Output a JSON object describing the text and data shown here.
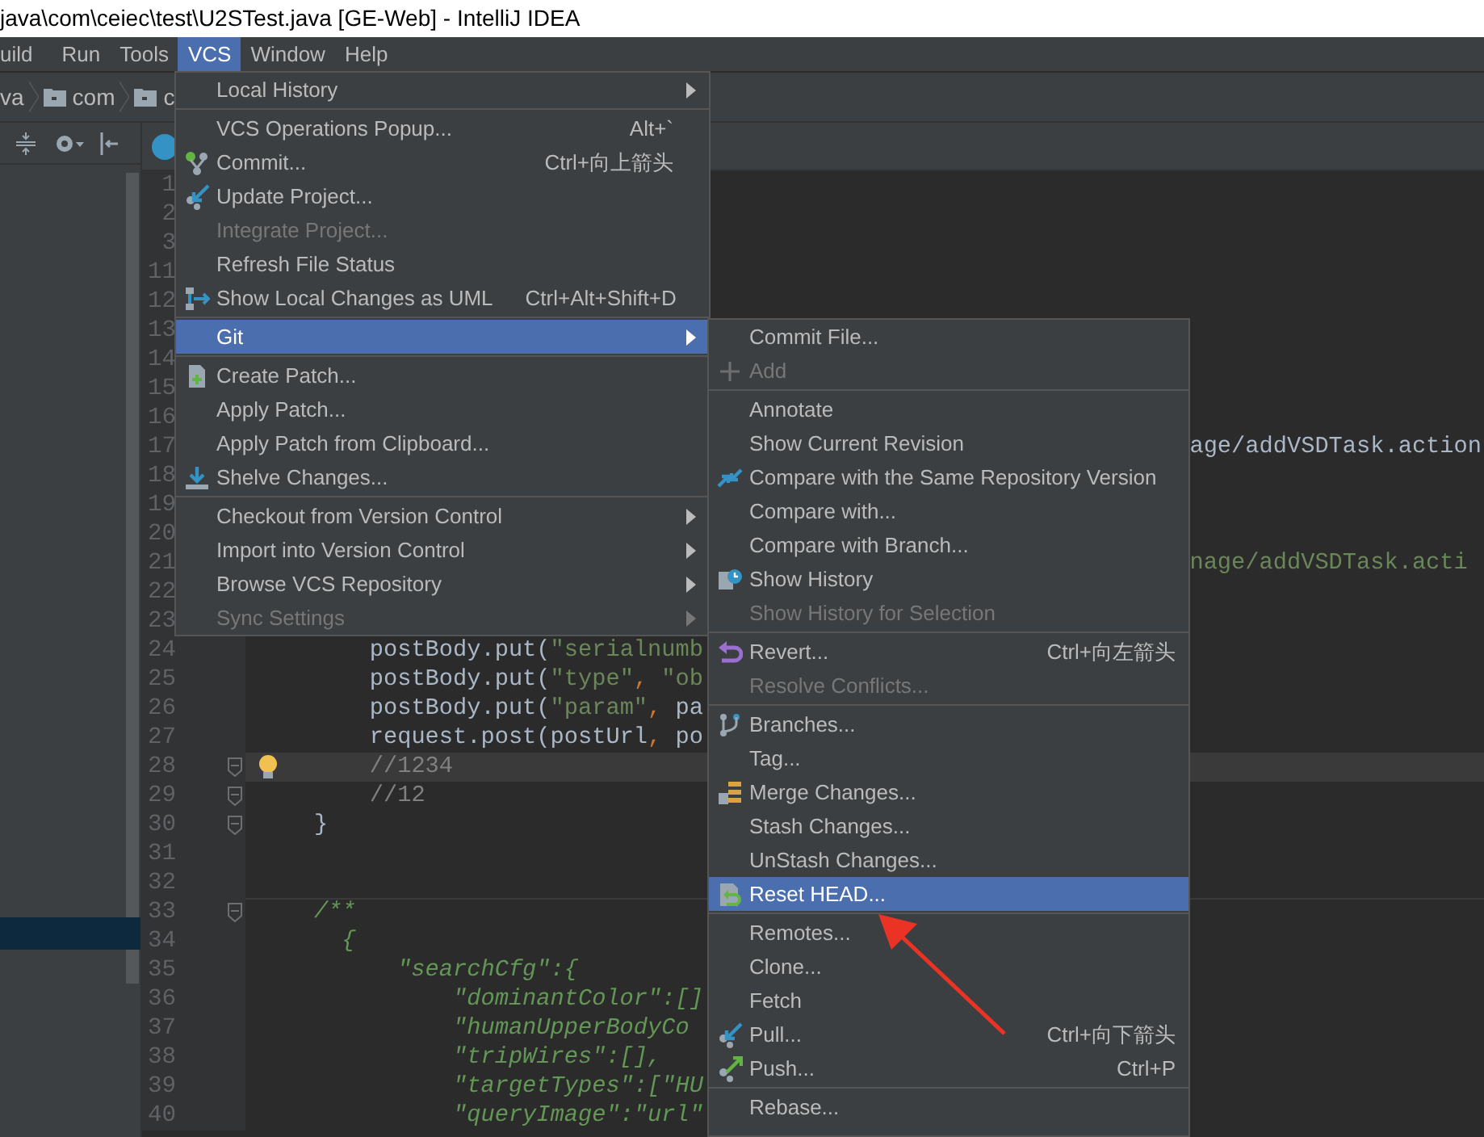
{
  "window": {
    "title": "java\\com\\ceiec\\test\\U2STest.java [GE-Web] - IntelliJ IDEA"
  },
  "menubar": [
    {
      "label": "uild",
      "selected": false
    },
    {
      "label": "Run",
      "selected": false
    },
    {
      "label": "Tools",
      "selected": false
    },
    {
      "label": "VCS",
      "selected": true
    },
    {
      "label": "Window",
      "selected": false
    },
    {
      "label": "Help",
      "selected": false
    }
  ],
  "breadcrumb": [
    {
      "label": "va",
      "kind": "text"
    },
    {
      "label": "com",
      "kind": "folder"
    },
    {
      "label": "c",
      "kind": "folder"
    }
  ],
  "editor": {
    "lines": [
      {
        "number": "1",
        "current": false,
        "fold": false,
        "divider": false
      },
      {
        "number": "2",
        "current": false,
        "fold": false,
        "divider": false
      },
      {
        "number": "3",
        "current": false,
        "fold": false,
        "divider": false
      },
      {
        "number": "11",
        "current": false,
        "fold": false,
        "divider": false
      },
      {
        "number": "12",
        "current": false,
        "fold": false,
        "divider": false
      },
      {
        "number": "13",
        "current": false,
        "fold": false,
        "divider": false
      },
      {
        "number": "14",
        "current": false,
        "fold": false,
        "divider": false
      },
      {
        "number": "15",
        "current": false,
        "fold": false,
        "divider": false
      },
      {
        "number": "16",
        "current": false,
        "fold": false,
        "divider": false
      },
      {
        "number": "17",
        "current": false,
        "fold": false,
        "divider": false,
        "code": [
          {
            "text": "                                                                   age/addVSDTask.action",
            "kind": "plain"
          }
        ]
      },
      {
        "number": "18",
        "current": false,
        "fold": false,
        "divider": false
      },
      {
        "number": "19",
        "current": false,
        "fold": false,
        "divider": false
      },
      {
        "number": "20",
        "current": false,
        "fold": false,
        "divider": false
      },
      {
        "number": "21",
        "current": false,
        "fold": false,
        "divider": false,
        "code": [
          {
            "text": "                                                                   nage/addVSDTask.acti",
            "kind": "string"
          }
        ]
      },
      {
        "number": "22",
        "current": false,
        "fold": false,
        "divider": false
      },
      {
        "number": "23",
        "current": false,
        "fold": false,
        "divider": false
      },
      {
        "number": "24",
        "current": false,
        "fold": false,
        "divider": false,
        "code": [
          {
            "text": "        postBody.put(",
            "kind": "plain"
          },
          {
            "text": "\"serialnumb",
            "kind": "string"
          }
        ]
      },
      {
        "number": "25",
        "current": false,
        "fold": false,
        "divider": false,
        "code": [
          {
            "text": "        postBody.put(",
            "kind": "plain"
          },
          {
            "text": "\"type\"",
            "kind": "string"
          },
          {
            "text": ",",
            "kind": "punct"
          },
          {
            "text": " \"ob",
            "kind": "string"
          }
        ]
      },
      {
        "number": "26",
        "current": false,
        "fold": false,
        "divider": false,
        "code": [
          {
            "text": "        postBody.put(",
            "kind": "plain"
          },
          {
            "text": "\"param\"",
            "kind": "string"
          },
          {
            "text": ",",
            "kind": "punct"
          },
          {
            "text": " pa",
            "kind": "plain"
          }
        ]
      },
      {
        "number": "27",
        "current": false,
        "fold": false,
        "divider": false,
        "code": [
          {
            "text": "        request.post(postUrl",
            "kind": "plain"
          },
          {
            "text": ",",
            "kind": "punct"
          },
          {
            "text": " po",
            "kind": "plain"
          }
        ]
      },
      {
        "number": "28",
        "current": true,
        "fold": true,
        "divider": false,
        "code": [
          {
            "text": "        //1234",
            "kind": "comment"
          }
        ]
      },
      {
        "number": "29",
        "current": false,
        "fold": true,
        "divider": false,
        "code": [
          {
            "text": "        //12",
            "kind": "comment"
          }
        ]
      },
      {
        "number": "30",
        "current": false,
        "fold": true,
        "divider": false,
        "code": [
          {
            "text": "    }",
            "kind": "plain"
          }
        ]
      },
      {
        "number": "31",
        "current": false,
        "fold": false,
        "divider": false
      },
      {
        "number": "32",
        "current": false,
        "fold": false,
        "divider": false
      },
      {
        "number": "33",
        "current": false,
        "fold": true,
        "divider": true,
        "code": [
          {
            "text": "    /**",
            "kind": "doc"
          }
        ]
      },
      {
        "number": "34",
        "current": false,
        "fold": false,
        "divider": false,
        "code": [
          {
            "text": "      {",
            "kind": "doc"
          }
        ]
      },
      {
        "number": "35",
        "current": false,
        "fold": false,
        "divider": false,
        "code": [
          {
            "text": "          \"searchCfg\":{",
            "kind": "doc"
          }
        ]
      },
      {
        "number": "36",
        "current": false,
        "fold": false,
        "divider": false,
        "code": [
          {
            "text": "              \"dominantColor\":[]",
            "kind": "doc"
          }
        ]
      },
      {
        "number": "37",
        "current": false,
        "fold": false,
        "divider": false,
        "code": [
          {
            "text": "              \"humanUpperBodyCo",
            "kind": "doc"
          }
        ]
      },
      {
        "number": "38",
        "current": false,
        "fold": false,
        "divider": false,
        "code": [
          {
            "text": "              \"tripWires\":[],",
            "kind": "doc"
          }
        ]
      },
      {
        "number": "39",
        "current": false,
        "fold": false,
        "divider": false,
        "code": [
          {
            "text": "              \"targetTypes\":[\"HU",
            "kind": "doc"
          }
        ]
      },
      {
        "number": "40",
        "current": false,
        "fold": false,
        "divider": false,
        "code": [
          {
            "text": "              \"queryImage\":\"url\"",
            "kind": "doc"
          }
        ]
      }
    ]
  },
  "vcs_menu": {
    "items": [
      {
        "kind": "item",
        "label": "Local History",
        "disabled": false,
        "selected": false,
        "submenu": true
      },
      {
        "kind": "separator"
      },
      {
        "kind": "item",
        "label": "VCS Operations Popup...",
        "shortcut": "Alt+`",
        "disabled": false,
        "selected": false,
        "submenu": false
      },
      {
        "kind": "item",
        "label": "Commit...",
        "shortcut": "Ctrl+向上箭头",
        "disabled": false,
        "selected": false,
        "submenu": false
      },
      {
        "kind": "item",
        "label": "Update Project...",
        "disabled": false,
        "selected": false,
        "submenu": false
      },
      {
        "kind": "item",
        "label": "Integrate Project...",
        "disabled": true,
        "selected": false,
        "submenu": false
      },
      {
        "kind": "item",
        "label": "Refresh File Status",
        "disabled": false,
        "selected": false,
        "submenu": false
      },
      {
        "kind": "item",
        "label": "Show Local Changes as UML",
        "shortcut": "Ctrl+Alt+Shift+D",
        "disabled": false,
        "selected": false,
        "submenu": false
      },
      {
        "kind": "separator"
      },
      {
        "kind": "item",
        "label": "Git",
        "disabled": false,
        "selected": true,
        "submenu": true
      },
      {
        "kind": "separator"
      },
      {
        "kind": "item",
        "label": "Create Patch...",
        "disabled": false,
        "selected": false,
        "submenu": false
      },
      {
        "kind": "item",
        "label": "Apply Patch...",
        "disabled": false,
        "selected": false,
        "submenu": false
      },
      {
        "kind": "item",
        "label": "Apply Patch from Clipboard...",
        "disabled": false,
        "selected": false,
        "submenu": false
      },
      {
        "kind": "item",
        "label": "Shelve Changes...",
        "disabled": false,
        "selected": false,
        "submenu": false
      },
      {
        "kind": "separator"
      },
      {
        "kind": "item",
        "label": "Checkout from Version Control",
        "disabled": false,
        "selected": false,
        "submenu": true
      },
      {
        "kind": "item",
        "label": "Import into Version Control",
        "disabled": false,
        "selected": false,
        "submenu": true
      },
      {
        "kind": "item",
        "label": "Browse VCS Repository",
        "disabled": false,
        "selected": false,
        "submenu": true
      },
      {
        "kind": "item",
        "label": "Sync Settings",
        "disabled": true,
        "selected": false,
        "submenu": true
      }
    ]
  },
  "git_menu": {
    "items": [
      {
        "kind": "item",
        "label": "Commit File...",
        "disabled": false,
        "selected": false
      },
      {
        "kind": "item",
        "label": "Add",
        "disabled": true,
        "selected": false
      },
      {
        "kind": "separator"
      },
      {
        "kind": "item",
        "label": "Annotate",
        "disabled": false,
        "selected": false
      },
      {
        "kind": "item",
        "label": "Show Current Revision",
        "disabled": false,
        "selected": false
      },
      {
        "kind": "item",
        "label": "Compare with the Same Repository Version",
        "disabled": false,
        "selected": false
      },
      {
        "kind": "item",
        "label": "Compare with...",
        "disabled": false,
        "selected": false
      },
      {
        "kind": "item",
        "label": "Compare with Branch...",
        "disabled": false,
        "selected": false
      },
      {
        "kind": "item",
        "label": "Show History",
        "disabled": false,
        "selected": false
      },
      {
        "kind": "item",
        "label": "Show History for Selection",
        "disabled": true,
        "selected": false
      },
      {
        "kind": "separator"
      },
      {
        "kind": "item",
        "label": "Revert...",
        "shortcut": "Ctrl+向左箭头",
        "disabled": false,
        "selected": false
      },
      {
        "kind": "item",
        "label": "Resolve Conflicts...",
        "disabled": true,
        "selected": false
      },
      {
        "kind": "separator"
      },
      {
        "kind": "item",
        "label": "Branches...",
        "disabled": false,
        "selected": false
      },
      {
        "kind": "item",
        "label": "Tag...",
        "disabled": false,
        "selected": false
      },
      {
        "kind": "item",
        "label": "Merge Changes...",
        "disabled": false,
        "selected": false
      },
      {
        "kind": "item",
        "label": "Stash Changes...",
        "disabled": false,
        "selected": false
      },
      {
        "kind": "item",
        "label": "UnStash Changes...",
        "disabled": false,
        "selected": false
      },
      {
        "kind": "item",
        "label": "Reset HEAD...",
        "disabled": false,
        "selected": true
      },
      {
        "kind": "separator"
      },
      {
        "kind": "item",
        "label": "Remotes...",
        "disabled": false,
        "selected": false
      },
      {
        "kind": "item",
        "label": "Clone...",
        "disabled": false,
        "selected": false
      },
      {
        "kind": "item",
        "label": "Fetch",
        "disabled": false,
        "selected": false
      },
      {
        "kind": "item",
        "label": "Pull...",
        "shortcut": "Ctrl+向下箭头",
        "disabled": false,
        "selected": false
      },
      {
        "kind": "item",
        "label": "Push...",
        "shortcut": "Ctrl+P",
        "disabled": false,
        "selected": false
      },
      {
        "kind": "separator"
      },
      {
        "kind": "item",
        "label": "Rebase...",
        "disabled": false,
        "selected": false
      }
    ]
  }
}
